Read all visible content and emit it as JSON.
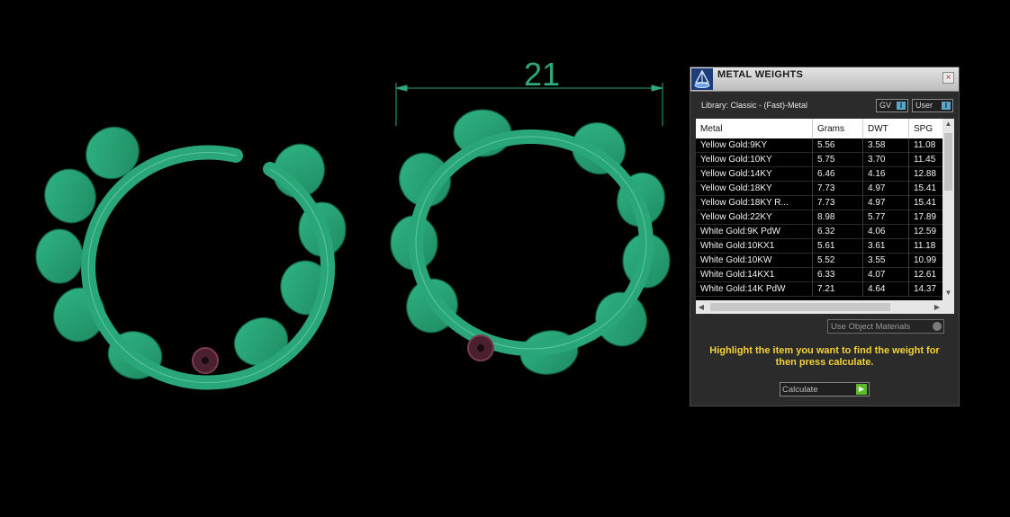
{
  "viewport": {
    "dimension_label": "21",
    "model_color": "#2aa77a",
    "dimension_color": "#2fa978"
  },
  "panel": {
    "title": "METAL WEIGHTS",
    "logo_icon": "gem-scale-icon",
    "close_icon": "close-icon",
    "library_label": "Library: Classic - (Fast)-Metal",
    "toggles": [
      {
        "label": "GV",
        "knob": "I"
      },
      {
        "label": "User",
        "knob": "I"
      }
    ],
    "table": {
      "columns": [
        "Metal",
        "Grams",
        "DWT",
        "SPG"
      ],
      "rows": [
        [
          "Yellow Gold:9KY",
          "5.56",
          "3.58",
          "11.08"
        ],
        [
          "Yellow Gold:10KY",
          "5.75",
          "3.70",
          "11.45"
        ],
        [
          "Yellow Gold:14KY",
          "6.46",
          "4.16",
          "12.88"
        ],
        [
          "Yellow Gold:18KY",
          "7.73",
          "4.97",
          "15.41"
        ],
        [
          "Yellow Gold:18KY R...",
          "7.73",
          "4.97",
          "15.41"
        ],
        [
          "Yellow Gold:22KY",
          "8.98",
          "5.77",
          "17.89"
        ],
        [
          "White Gold:9K PdW",
          "6.32",
          "4.06",
          "12.59"
        ],
        [
          "White Gold:10KX1",
          "5.61",
          "3.61",
          "11.18"
        ],
        [
          "White Gold:10KW",
          "5.52",
          "3.55",
          "10.99"
        ],
        [
          "White Gold:14KX1",
          "6.33",
          "4.07",
          "12.61"
        ],
        [
          "White Gold:14K PdW",
          "7.21",
          "4.64",
          "14.37"
        ]
      ]
    },
    "use_materials_label": "Use Object Materials",
    "instruction": "Highlight the item you want to find the weight for then press calculate.",
    "calculate_label": "Calculate",
    "colors": {
      "panel_bg": "#2b2b2b",
      "instruction": "#f3d13a",
      "toggle_knob": "#5aa6c8",
      "calc_go": "#5bbb2a"
    }
  }
}
